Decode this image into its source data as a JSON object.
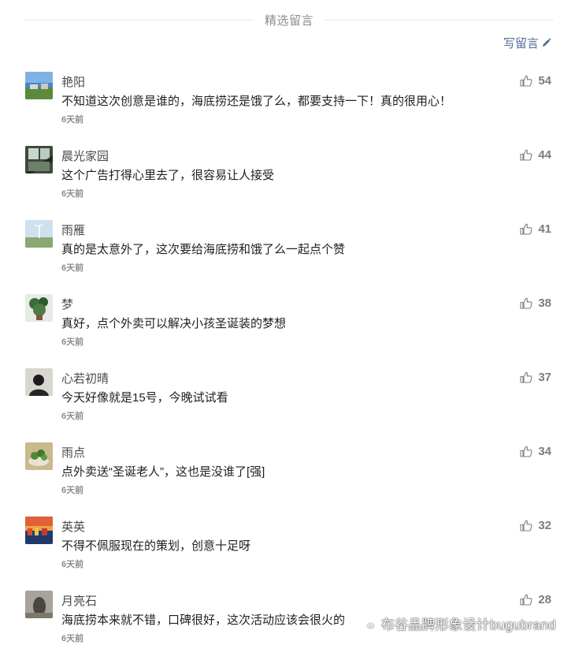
{
  "header": {
    "title": "精选留言",
    "write_label": "写留言",
    "write_icon": "pencil-icon",
    "link_color": "#576b95"
  },
  "comments": [
    {
      "nickname": "艳阳",
      "content": "不知道这次创意是谁的，海底捞还是饿了么，都要支持一下！真的很用心！",
      "time": "6天前",
      "likes": "54"
    },
    {
      "nickname": "晨光家园",
      "content": "这个广告打得心里去了，很容易让人接受",
      "time": "6天前",
      "likes": "44"
    },
    {
      "nickname": "雨雁",
      "content": "真的是太意外了，这次要给海底捞和饿了么一起点个赞",
      "time": "6天前",
      "likes": "41"
    },
    {
      "nickname": "梦",
      "content": "真好，点个外卖可以解决小孩圣诞装的梦想",
      "time": "6天前",
      "likes": "38"
    },
    {
      "nickname": "心若初晴",
      "content": "今天好像就是15号，今晚试试看",
      "time": "6天前",
      "likes": "37"
    },
    {
      "nickname": "雨点",
      "content": "点外卖送“圣诞老人”，这也是没谁了[强]",
      "time": "6天前",
      "likes": "34"
    },
    {
      "nickname": "英英",
      "content": "不得不佩服现在的策划，创意十足呀",
      "time": "6天前",
      "likes": "32"
    },
    {
      "nickname": "月亮石",
      "content": "海底捞本来就不错，口碑很好，这次活动应该会很火的",
      "time": "6天前",
      "likes": "28"
    }
  ],
  "watermark": {
    "text": "布谷品牌形象设计bugubrand",
    "icon": "wechat-icon"
  }
}
